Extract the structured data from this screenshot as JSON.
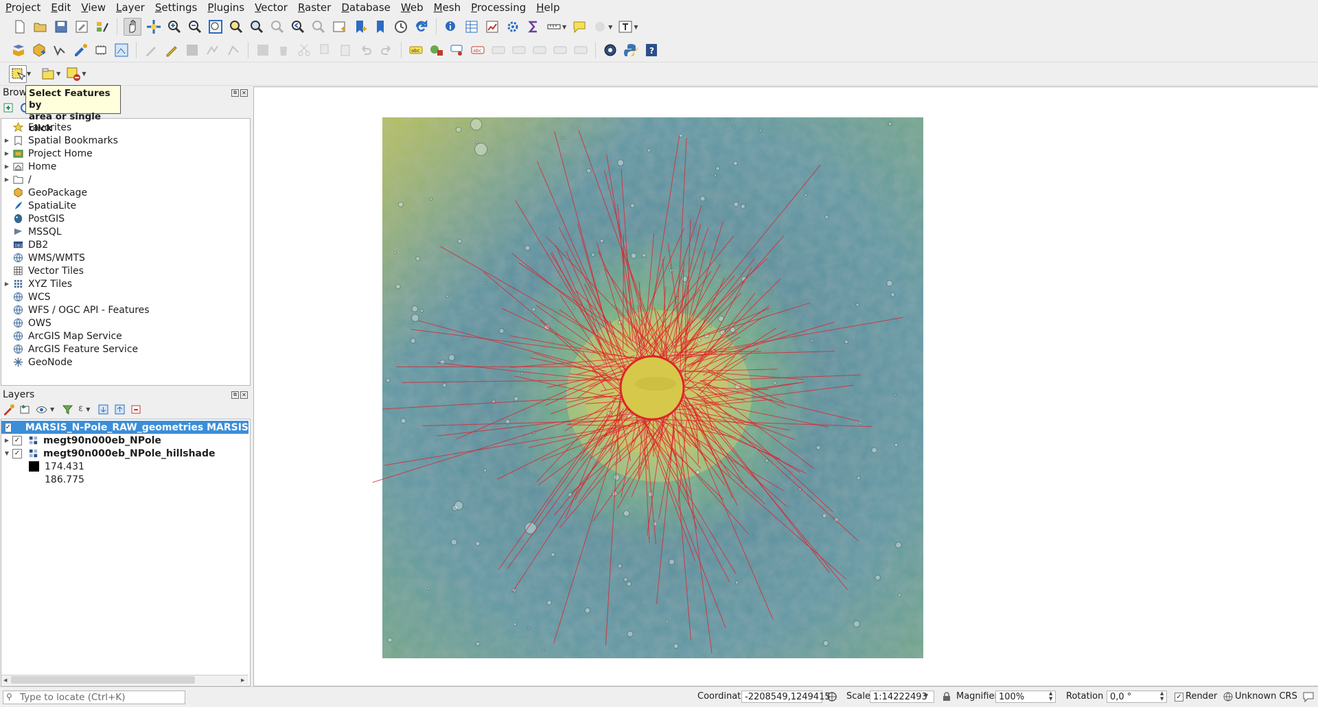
{
  "menubar": [
    "Project",
    "Edit",
    "View",
    "Layer",
    "Settings",
    "Plugins",
    "Vector",
    "Raster",
    "Database",
    "Web",
    "Mesh",
    "Processing",
    "Help"
  ],
  "tooltip": {
    "line1": "Select Features by",
    "line2": "area or single click"
  },
  "browser": {
    "title": "Browser",
    "items": [
      {
        "label": "Favorites",
        "icon": "star-icon",
        "arrow": false
      },
      {
        "label": "Spatial Bookmarks",
        "icon": "bookmark-icon",
        "arrow": true
      },
      {
        "label": "Project Home",
        "icon": "project-home-icon",
        "arrow": true
      },
      {
        "label": "Home",
        "icon": "home-folder-icon",
        "arrow": true
      },
      {
        "label": "/",
        "icon": "folder-icon",
        "arrow": true
      },
      {
        "label": "GeoPackage",
        "icon": "geopackage-icon",
        "arrow": false
      },
      {
        "label": "SpatiaLite",
        "icon": "spatialite-icon",
        "arrow": false
      },
      {
        "label": "PostGIS",
        "icon": "postgis-icon",
        "arrow": false
      },
      {
        "label": "MSSQL",
        "icon": "mssql-icon",
        "arrow": false
      },
      {
        "label": "DB2",
        "icon": "db2-icon",
        "arrow": false
      },
      {
        "label": "WMS/WMTS",
        "icon": "globe-icon",
        "arrow": false
      },
      {
        "label": "Vector Tiles",
        "icon": "grid-icon",
        "arrow": false
      },
      {
        "label": "XYZ Tiles",
        "icon": "tiles-icon",
        "arrow": true
      },
      {
        "label": "WCS",
        "icon": "globe-icon",
        "arrow": false
      },
      {
        "label": "WFS / OGC API - Features",
        "icon": "globe-icon",
        "arrow": false
      },
      {
        "label": "OWS",
        "icon": "globe-icon",
        "arrow": false
      },
      {
        "label": "ArcGIS Map Service",
        "icon": "globe-icon",
        "arrow": false
      },
      {
        "label": "ArcGIS Feature Service",
        "icon": "globe-icon",
        "arrow": false
      },
      {
        "label": "GeoNode",
        "icon": "geonode-icon",
        "arrow": false
      }
    ]
  },
  "layers": {
    "title": "Layers",
    "items": [
      {
        "label": "MARSIS_N-Pole_RAW_geometries MARSIS",
        "checked": true,
        "selected": true,
        "expanded": false
      },
      {
        "label": "megt90n000eb_NPole",
        "checked": true,
        "selected": false,
        "expanded": false
      },
      {
        "label": "megt90n000eb_NPole_hillshade",
        "checked": true,
        "selected": false,
        "expanded": true
      }
    ],
    "legend": [
      "174.431",
      "186.775"
    ]
  },
  "statusbar": {
    "locate_placeholder": "Type to locate (Ctrl+K)",
    "coordinate_label": "Coordinate",
    "coordinate_value": "-2208549,1249415",
    "scale_label": "Scale",
    "scale_value": "1:14222493",
    "magnifier_label": "Magnifier",
    "magnifier_value": "100%",
    "rotation_label": "Rotation",
    "rotation_value": "0,0 °",
    "render_label": "Render",
    "crs_label": "Unknown CRS"
  },
  "colors": {
    "selection": "#3b8ed8",
    "tracks": "#e0222c",
    "cap": "#d8c94a"
  }
}
